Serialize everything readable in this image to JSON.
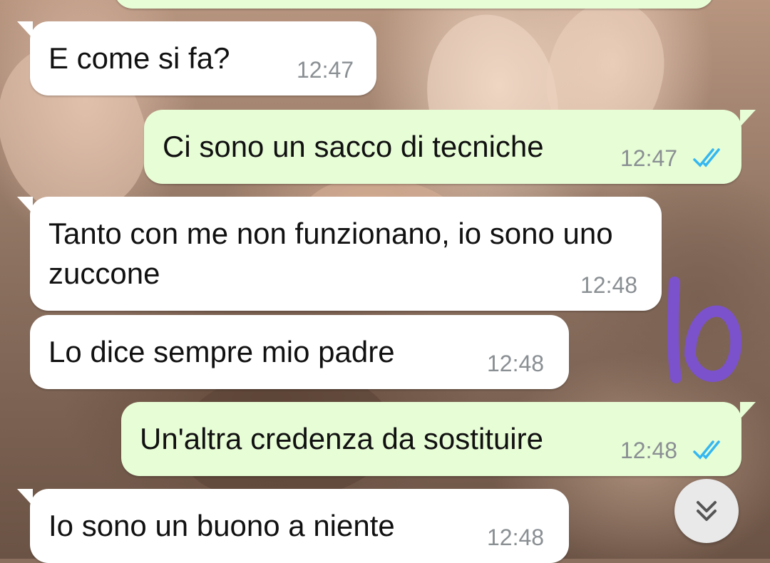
{
  "messages": [
    {
      "direction": "incoming",
      "text": "E come si fa?",
      "time": "12:47"
    },
    {
      "direction": "outgoing",
      "text": "Ci sono un sacco di tecniche",
      "time": "12:47",
      "status": "read"
    },
    {
      "direction": "incoming",
      "text": "Tanto con me non funzionano, io sono uno zuccone",
      "time": "12:48"
    },
    {
      "direction": "incoming",
      "text": "Lo dice sempre mio padre",
      "time": "12:48"
    },
    {
      "direction": "outgoing",
      "text": "Un'altra credenza da sostituire",
      "time": "12:48",
      "status": "read"
    },
    {
      "direction": "incoming",
      "text": "Io sono un buono a niente",
      "time": "12:48"
    }
  ],
  "scroll_button": {
    "icon": "double-chevron-down-icon"
  },
  "colors": {
    "incoming_bubble": "#ffffff",
    "outgoing_bubble": "#e7fdd6",
    "timestamp": "#8a8f93",
    "read_ticks": "#34b7f1",
    "doodle": "#7b52cc"
  }
}
